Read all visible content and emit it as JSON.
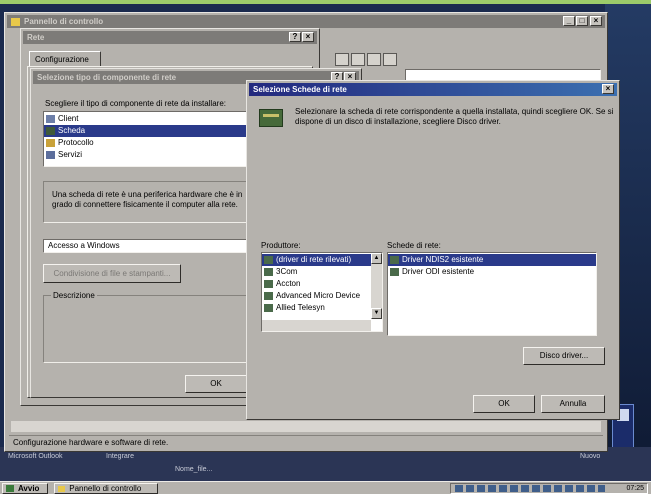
{
  "control_panel": {
    "title": "Pannello di controllo",
    "status": "Configurazione hardware e software di rete."
  },
  "rete": {
    "title": "Rete",
    "tab": "Configurazione"
  },
  "select_type": {
    "title": "Selezione tipo di componente di rete",
    "prompt": "Scegliere il tipo di componente di rete da installare:",
    "items": [
      "Client",
      "Scheda",
      "Protocollo",
      "Servizi"
    ],
    "selected_index": 1,
    "description": "Una scheda di rete è una periferica hardware che è in grado di connettere fisicamente il computer alla rete.",
    "logon_value": "Accesso a Windows",
    "file_sharing_button": "Condivisione di file e stampanti...",
    "description_label": "Descrizione",
    "ok_label": "OK"
  },
  "select_adapter": {
    "title": "Selezione Schede di rete",
    "instructions": "Selezionare la scheda di rete corrispondente a quella installata, quindi scegliere OK. Se si dispone di un disco di installazione, scegliere Disco driver.",
    "manufacturers_label": "Produttore:",
    "manufacturers": [
      "(driver di rete rilevati)",
      "3Com",
      "Accton",
      "Advanced Micro Device",
      "Allied Telesyn"
    ],
    "manufacturers_selected": 0,
    "adapters_label": "Schede di rete:",
    "adapters": [
      "Driver NDIS2 esistente",
      "Driver ODI esistente"
    ],
    "adapters_selected": 0,
    "disk_button": "Disco driver...",
    "ok_label": "OK",
    "cancel_label": "Annulla"
  },
  "desktop": {
    "labels": [
      "Microsoft Outlook",
      "Integrare",
      "Nome_file..."
    ],
    "recycle_label": "Nuovo"
  },
  "taskbar": {
    "start_label": "Avvio",
    "task_label": "Pannello di controllo",
    "clock": "07:25"
  },
  "colors": {
    "title_active": "#23297e",
    "selection": "#2a3a8a",
    "face": "#b5b2ad"
  }
}
